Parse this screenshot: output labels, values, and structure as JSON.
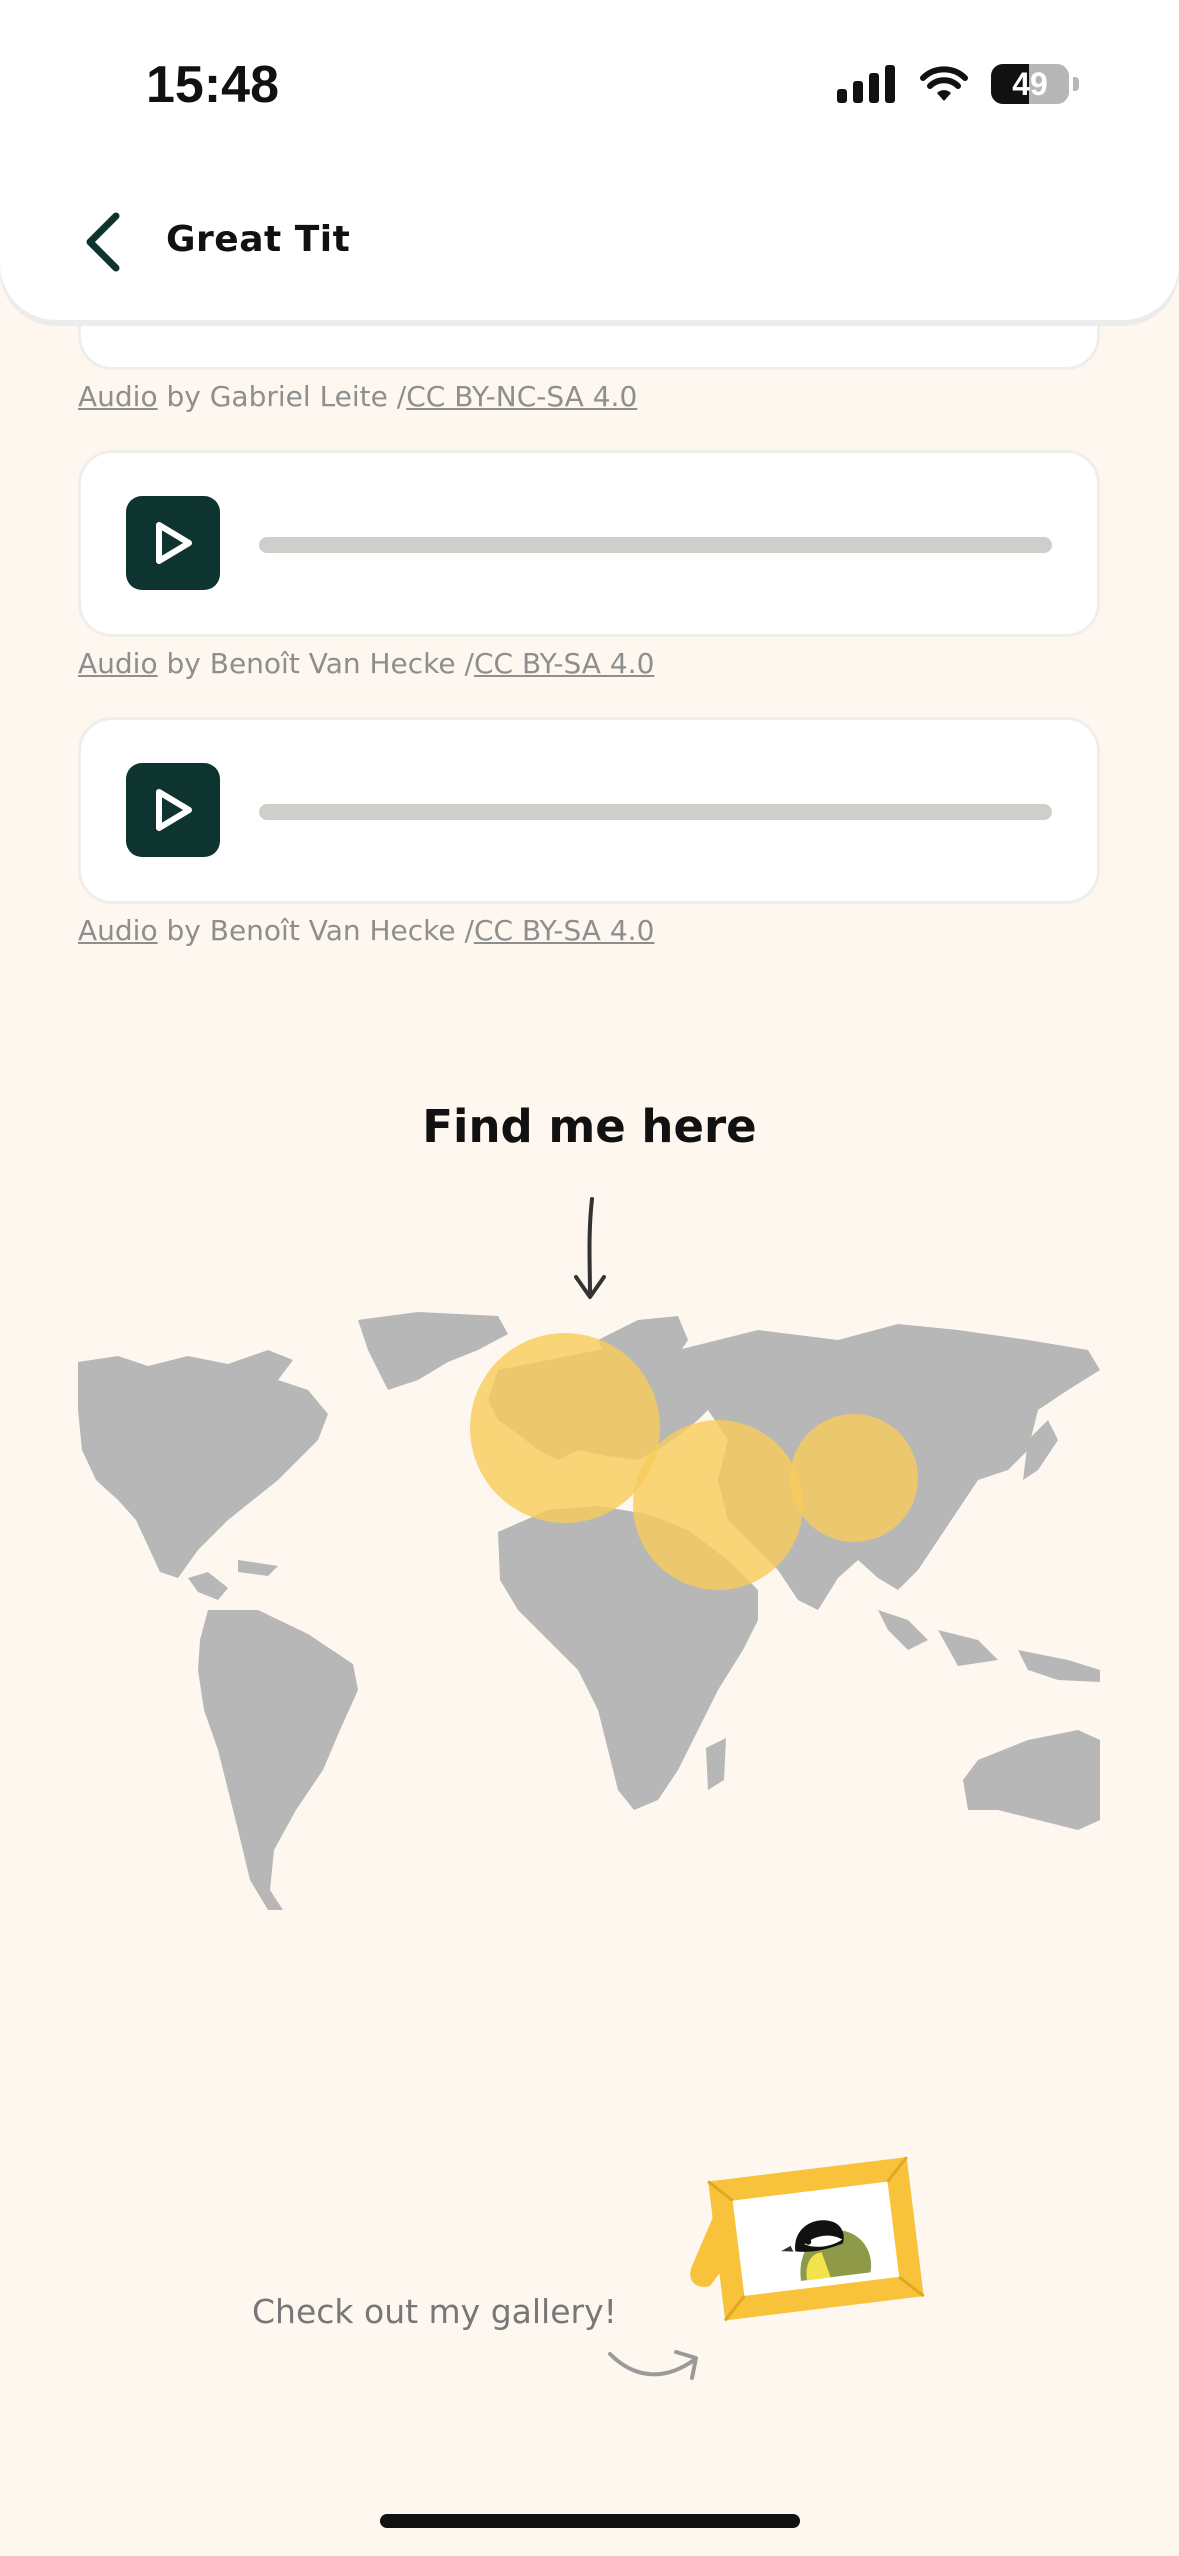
{
  "status_bar": {
    "time": "15:48",
    "battery": "49"
  },
  "header": {
    "title": "Great Tit"
  },
  "audio_items": [
    {
      "prefix": "Audio",
      "by": " by Gabriel Leite /",
      "license": "CC BY-NC-SA 4.0"
    },
    {
      "prefix": "Audio",
      "by": " by Benoît Van Hecke /",
      "license": "CC BY-SA 4.0"
    },
    {
      "prefix": "Audio",
      "by": " by Benoît Van Hecke /",
      "license": "CC BY-SA 4.0"
    }
  ],
  "map_section": {
    "title": "Find me here"
  },
  "gallery": {
    "label": "Check out my gallery!"
  },
  "colors": {
    "background": "#FDF7F0",
    "play_button": "#0E3430",
    "map_land": "#B7B7B7",
    "range_highlight": "#F7CC5A",
    "frame": "#F8C33A"
  }
}
